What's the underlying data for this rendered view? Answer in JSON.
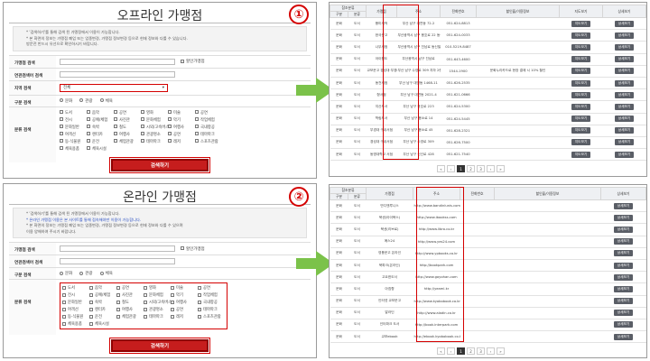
{
  "top": {
    "badge": "①",
    "title": "오프라인 가맹점",
    "notice": [
      "* '검색하기'를 통해 검색 된 가맹정에서 이용이 가능합니다.",
      "* 본 화면의 정보는 가맹점 폐업 또는 업종변경, 가맹점 정보변경 등으로 현재 정보와 다를 수 있습니다.",
      "   방문전 반드시 유선으로 확인하시기 바랍니다."
    ],
    "rows": {
      "name_label": "가맹점 검색",
      "discount_label": "할인가맹점",
      "related_label": "연관검색어 검색",
      "region_label": "지역 검색",
      "region_value": "전체",
      "type_label": "구분 검색",
      "type_options": [
        "문화",
        "관광",
        "체육"
      ],
      "category_label": "분류 검색"
    },
    "search_button": "검색하기"
  },
  "bottom": {
    "badge": "②",
    "title": "온라인 가맹점",
    "notice": [
      "* '검색하기'를 통해 검색 된 가맹정에서 이용이 가능합니다.",
      "* 온라인 가맹점 이용은 본 사이트를 통해 접속해야만 이용이 가능합니다.",
      "* 본 화면의 정보는 가맹점 폐업 또는 업종변경, 가맹점 정보변경 등으로 현재 정보와 다를 수 있으며",
      "   이용 양해하여 주시기 바랍니다."
    ],
    "rows": {
      "name_label": "가맹점 검색",
      "discount_label": "할인가맹점",
      "related_label": "연관검색어 검색",
      "type_label": "구분 검색",
      "type_options": [
        "문화",
        "관광",
        "체육"
      ],
      "category_label": "분류 검색"
    },
    "search_button": "검색하기"
  },
  "categories": [
    "도서",
    "음악",
    "공연",
    "영화",
    "미술",
    "공연",
    "전시",
    "공예/체험",
    "사진관",
    "문화체험",
    "악기",
    "작업체험",
    "문화일반",
    "숙박",
    "철도",
    "시외/고속버스",
    "여행사",
    "국내항공",
    "여객선",
    "렌터카",
    "여행사",
    "관광명소",
    "공연",
    "테마파크",
    "동·식물원",
    "운전",
    "체험관광",
    "테마파크",
    "레저",
    "스포츠관람",
    "체육용품",
    "체육시설"
  ],
  "offline_table": {
    "group_header": "참조분류",
    "headers": [
      "구분",
      "분류",
      "가맹점",
      "주소",
      "전화번호",
      "할인율/이용정보",
      "지도보기",
      "상세보기"
    ],
    "rows": [
      [
        "문화",
        "도서",
        "풍미서적",
        "부산 남구 대연동 72-2",
        "051-624-8813",
        "",
        "지도보기",
        "상세보기"
      ],
      [
        "문화",
        "도서",
        "한국문고",
        "부산광역시 남구 용호로 22 동신빌딩 1층 (용호동)",
        "051-624-0033",
        "",
        "지도보기",
        "상세보기"
      ],
      [
        "문화",
        "도서",
        "나무서점",
        "부산광역시 남구 진남로 동신빌딩 2층",
        "010-5219-8487",
        "",
        "지도보기",
        "상세보기"
      ],
      [
        "문화",
        "도서",
        "아이원도",
        "부산광역시 남구 진남로",
        "051-643-4600",
        "",
        "지도보기",
        "상세보기"
      ],
      [
        "문화",
        "도서",
        "교보문고 경성대·부경대입구",
        "부산 남구 수영로 309 지하 2층",
        "1544-1900",
        "문화누리카드로 현장 결제 시 10% 할인",
        "지도보기",
        "상세보기"
      ],
      [
        "문화",
        "도서",
        "동천서점",
        "부산 남구 대연동 1468-11",
        "051-626-2535",
        "",
        "지도보기",
        "상세보기"
      ],
      [
        "문화",
        "도서",
        "형서점",
        "부산 남구 대연동 2021-4",
        "051-621-0666",
        "",
        "지도보기",
        "상세보기"
      ],
      [
        "문화",
        "도서",
        "지산도서",
        "부산 남구 용호로 223",
        "051-624-5300",
        "",
        "지도보기",
        "상세보기"
      ],
      [
        "문화",
        "도서",
        "학림도서",
        "부산 남구 용소로 14",
        "051-624-5445",
        "",
        "지도보기",
        "상세보기"
      ],
      [
        "문화",
        "도서",
        "부경대 구내서점",
        "부산 남구 용소로 45",
        "051-628-2321",
        "",
        "지도보기",
        "상세보기"
      ],
      [
        "문화",
        "도서",
        "경성대 구내서점",
        "부산 남구 수영로 309",
        "051-626-7500",
        "",
        "지도보기",
        "상세보기"
      ],
      [
        "문화",
        "도서",
        "동명대학교 서점",
        "부산 남구 신선로 428",
        "051-621-7540",
        "",
        "지도보기",
        "상세보기"
      ]
    ]
  },
  "online_table": {
    "group_header": "참조분류",
    "headers": [
      "구분",
      "분류",
      "가맹점",
      "주소",
      "전화번호",
      "할인율/이용정보",
      "상세보기"
    ],
    "rows": [
      [
        "문화",
        "도서",
        "반디앤루니스",
        "http://www.bandinlunis.com",
        "",
        "",
        "상세보기"
      ],
      [
        "문화",
        "도서",
        "북센(아이북스)",
        "http://www.ibookss.com",
        "",
        "",
        "상세보기"
      ],
      [
        "문화",
        "도서",
        "북센(리브로)",
        "http://www.libro.co.kr",
        "",
        "",
        "상세보기"
      ],
      [
        "문화",
        "도서",
        "예스24",
        "http://www.yes24.com",
        "",
        "",
        "상세보기"
      ],
      [
        "문화",
        "도서",
        "영풍문고 온라인",
        "http://www.ypbooks.co.kr",
        "",
        "",
        "상세보기"
      ],
      [
        "문화",
        "도서",
        "북파크(온라인)",
        "http://bookpark.com",
        "",
        "",
        "상세보기"
      ],
      [
        "문화",
        "도서",
        "고요한도서",
        "http://www.goyohan.com",
        "",
        "",
        "상세보기"
      ],
      [
        "문화",
        "도서",
        "아침향",
        "http://yeaml.kr",
        "",
        "",
        "상세보기"
      ],
      [
        "문화",
        "도서",
        "인터넷 교보문고",
        "http://www.kyobobook.co.kr",
        "",
        "",
        "상세보기"
      ],
      [
        "문화",
        "도서",
        "알라딘",
        "http://www.aladin.co.kr",
        "",
        "",
        "상세보기"
      ],
      [
        "문화",
        "도서",
        "인터파크 도서",
        "http://book.interpark.com",
        "",
        "",
        "상세보기"
      ],
      [
        "문화",
        "도서",
        "교보ebook",
        "http://ebook.kyobobook.co.kr",
        "",
        "",
        "상세보기"
      ]
    ]
  },
  "pagination": [
    "«",
    "‹",
    "1",
    "2",
    "3",
    "›",
    "»"
  ]
}
